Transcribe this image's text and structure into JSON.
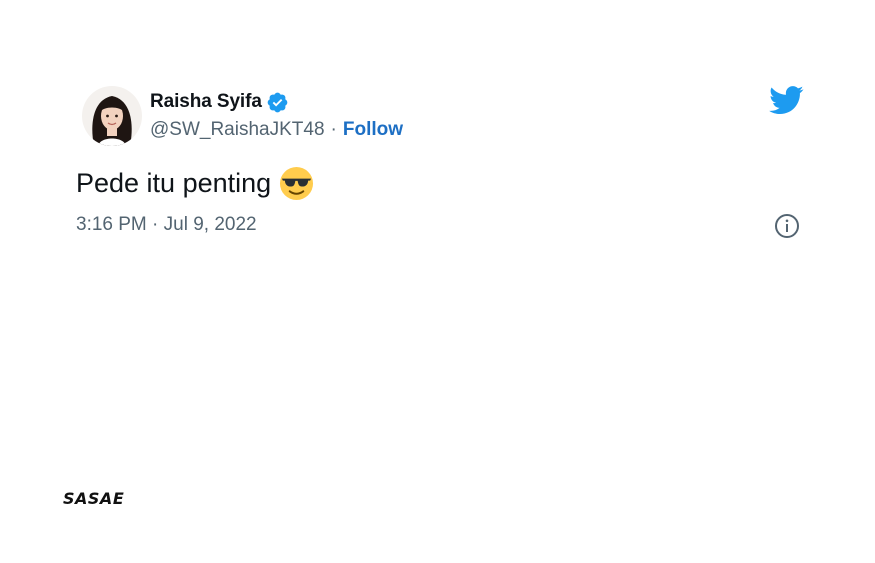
{
  "tweet": {
    "author": {
      "display_name": "Raisha Syifa",
      "handle": "@SW_RaishaJKT48",
      "separator": "·",
      "follow_label": "Follow",
      "verified": true
    },
    "text": "Pede itu penting",
    "emoji": "smiling-face-with-sunglasses",
    "timestamp": "3:16 PM · Jul 9, 2022"
  },
  "watermark": {
    "text": "SASAE"
  },
  "colors": {
    "twitter_blue": "#1d9bf0",
    "follow_link": "#1d6fc4",
    "secondary_text": "#536471",
    "primary_text": "#0f1419",
    "emoji_yellow": "#ffcc4d"
  },
  "icons": [
    "verified-badge-icon",
    "twitter-bird-icon",
    "info-icon",
    "sunglasses-emoji"
  ]
}
